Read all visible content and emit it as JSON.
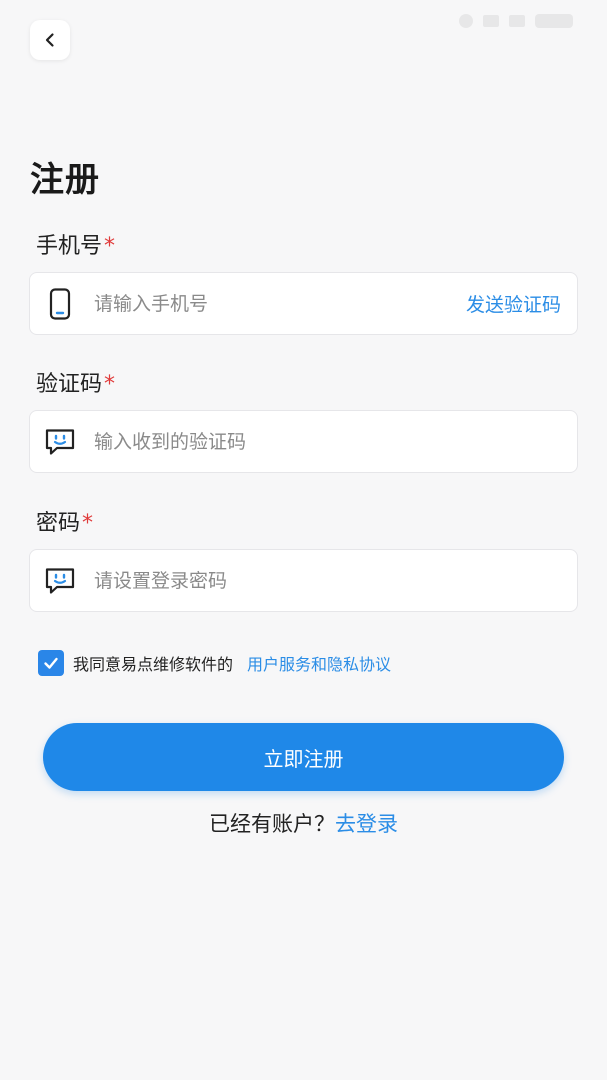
{
  "page": {
    "title": "注册"
  },
  "fields": {
    "phone": {
      "label": "手机号",
      "required_mark": "*",
      "placeholder": "请输入手机号",
      "value": "",
      "icon": "phone-icon",
      "action_label": "发送验证码"
    },
    "code": {
      "label": "验证码",
      "required_mark": "*",
      "placeholder": "输入收到的验证码",
      "value": "",
      "icon": "message-smile-icon"
    },
    "password": {
      "label": "密码",
      "required_mark": "*",
      "placeholder": "请设置登录密码",
      "value": "",
      "icon": "message-smile-icon"
    }
  },
  "agreement": {
    "checked": true,
    "text": "我同意易点维修软件的",
    "link_label": "用户服务和隐私协议"
  },
  "register_button": {
    "label": "立即注册"
  },
  "login_prompt": {
    "text": "已经有账户？",
    "link_label": "去登录"
  },
  "colors": {
    "accent": "#1f88e8",
    "link": "#2b8de6",
    "required": "#e03b3b",
    "background": "#f7f7f8"
  }
}
